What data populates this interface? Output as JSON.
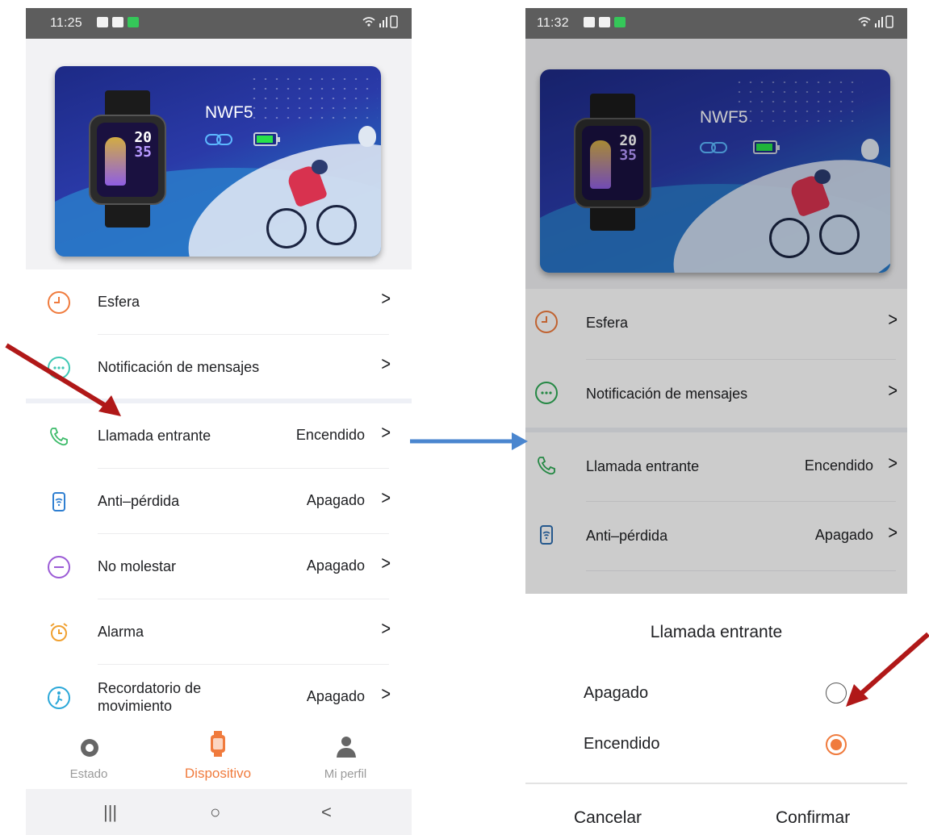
{
  "colors": {
    "accent": "#f07b3d",
    "annotation_red": "#b01818",
    "annotation_blue": "#4a86cf"
  },
  "left_screen": {
    "status": {
      "time": "11:25",
      "icons": [
        "video-icon",
        "message-icon",
        "activity-icon"
      ],
      "right_icons": "wifi signal battery"
    },
    "device": {
      "name": "NWF5",
      "connection_icon": "link-icon",
      "battery_icon": "battery-icon"
    },
    "menu": [
      {
        "icon": "clock-icon",
        "label": "Esfera",
        "value": ""
      },
      {
        "icon": "message-bubble-icon",
        "label": "Notificación de mensajes",
        "value": ""
      },
      {
        "icon": "phone-icon",
        "label": "Llamada entrante",
        "value": "Encendido"
      },
      {
        "icon": "anti-lost-icon",
        "label": "Anti–pérdida",
        "value": "Apagado"
      },
      {
        "icon": "do-not-disturb-icon",
        "label": "No molestar",
        "value": "Apagado"
      },
      {
        "icon": "alarm-icon",
        "label": "Alarma",
        "value": ""
      },
      {
        "icon": "movement-icon",
        "label": "Recordatorio de movimiento",
        "value": "Apagado"
      }
    ],
    "tabs": [
      {
        "icon": "status-icon",
        "label": "Estado",
        "active": false
      },
      {
        "icon": "watch-icon",
        "label": "Dispositivo",
        "active": true
      },
      {
        "icon": "person-icon",
        "label": "Mi perfil",
        "active": false
      }
    ],
    "nav": {
      "recents": "|||",
      "home": "○",
      "back": "<"
    }
  },
  "right_screen": {
    "status": {
      "time": "11:32",
      "icons": [
        "image-icon",
        "message-icon",
        "activity-icon"
      ]
    },
    "device": {
      "name": "NWF5"
    },
    "menu": [
      {
        "icon": "clock-icon",
        "label": "Esfera",
        "value": ""
      },
      {
        "icon": "message-bubble-icon",
        "label": "Notificación de mensajes",
        "value": ""
      },
      {
        "icon": "phone-icon",
        "label": "Llamada entrante",
        "value": "Encendido"
      },
      {
        "icon": "anti-lost-icon",
        "label": "Anti–pérdida",
        "value": "Apagado"
      }
    ],
    "sheet": {
      "title": "Llamada entrante",
      "options": [
        {
          "label": "Apagado",
          "selected": false
        },
        {
          "label": "Encendido",
          "selected": true
        }
      ],
      "cancel": "Cancelar",
      "confirm": "Confirmar"
    }
  },
  "watch_face": {
    "hour": "20",
    "minute": "35"
  }
}
